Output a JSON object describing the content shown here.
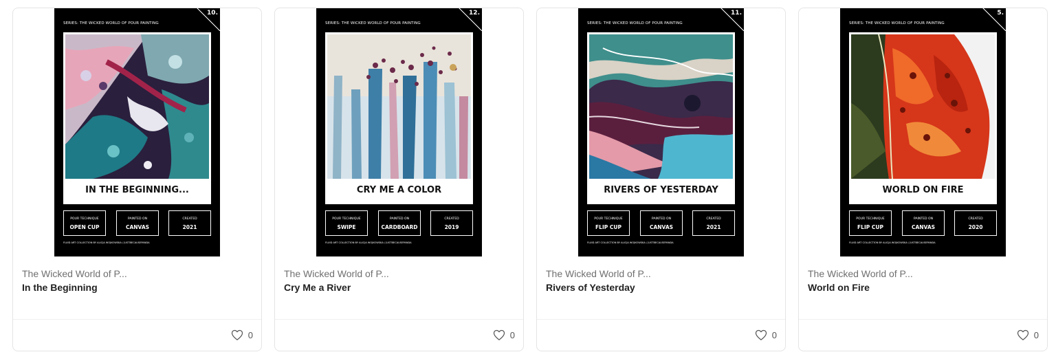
{
  "cards": [
    {
      "poster": {
        "series": "SERIES: THE WICKED WORLD OF POUR PAINTING",
        "number": "10.",
        "title": "IN THE BEGINNING...",
        "boxes": [
          {
            "label": "POUR TECHNIQUE",
            "value": "OPEN CUP"
          },
          {
            "label": "PAINTED ON",
            "value": "CANVAS"
          },
          {
            "label": "CREATED",
            "value": "2021"
          }
        ],
        "credit": "FLUID ART COLLECTION BY ALICJA WOJKOWSKA / JUSTBECAUSEPANDA"
      },
      "collection": "The Wicked World of P...",
      "title": "In the Beginning",
      "likes": "0"
    },
    {
      "poster": {
        "series": "SERIES: THE WICKED WORLD OF POUR PAINTING",
        "number": "12.",
        "title": "CRY ME A COLOR",
        "boxes": [
          {
            "label": "POUR TECHNIQUE",
            "value": "SWIPE"
          },
          {
            "label": "PAINTED ON",
            "value": "CARDBOARD"
          },
          {
            "label": "CREATED",
            "value": "2019"
          }
        ],
        "credit": "FLUID ART COLLECTION BY ALICJA WOJKOWSKA / JUSTBECAUSEPANDA"
      },
      "collection": "The Wicked World of P...",
      "title": "Cry Me a River",
      "likes": "0"
    },
    {
      "poster": {
        "series": "SERIES: THE WICKED WORLD OF POUR PAINTING",
        "number": "11.",
        "title": "RIVERS OF YESTERDAY",
        "boxes": [
          {
            "label": "POUR TECHNIQUE",
            "value": "FLIP CUP"
          },
          {
            "label": "PAINTED ON",
            "value": "CANVAS"
          },
          {
            "label": "CREATED",
            "value": "2021"
          }
        ],
        "credit": "FLUID ART COLLECTION BY ALICJA WOJKOWSKA / JUSTBECAUSEPANDA"
      },
      "collection": "The Wicked World of P...",
      "title": "Rivers of Yesterday",
      "likes": "0"
    },
    {
      "poster": {
        "series": "SERIES: THE WICKED WORLD OF POUR PAINTING",
        "number": "5.",
        "title": "WORLD ON FIRE",
        "boxes": [
          {
            "label": "POUR TECHNIQUE",
            "value": "FLIP CUP"
          },
          {
            "label": "PAINTED ON",
            "value": "CANVAS"
          },
          {
            "label": "CREATED",
            "value": "2020"
          }
        ],
        "credit": "FLUID ART COLLECTION BY ALICJA WOJKOWSKA / JUSTBECAUSEPANDA"
      },
      "collection": "The Wicked World of P...",
      "title": "World on Fire",
      "likes": "0"
    }
  ],
  "icons": {
    "like": "heart-outline-icon"
  },
  "colors": {
    "poster_bg": "#000000",
    "title_text": "#222222",
    "collection_text": "#6f6f6f"
  }
}
